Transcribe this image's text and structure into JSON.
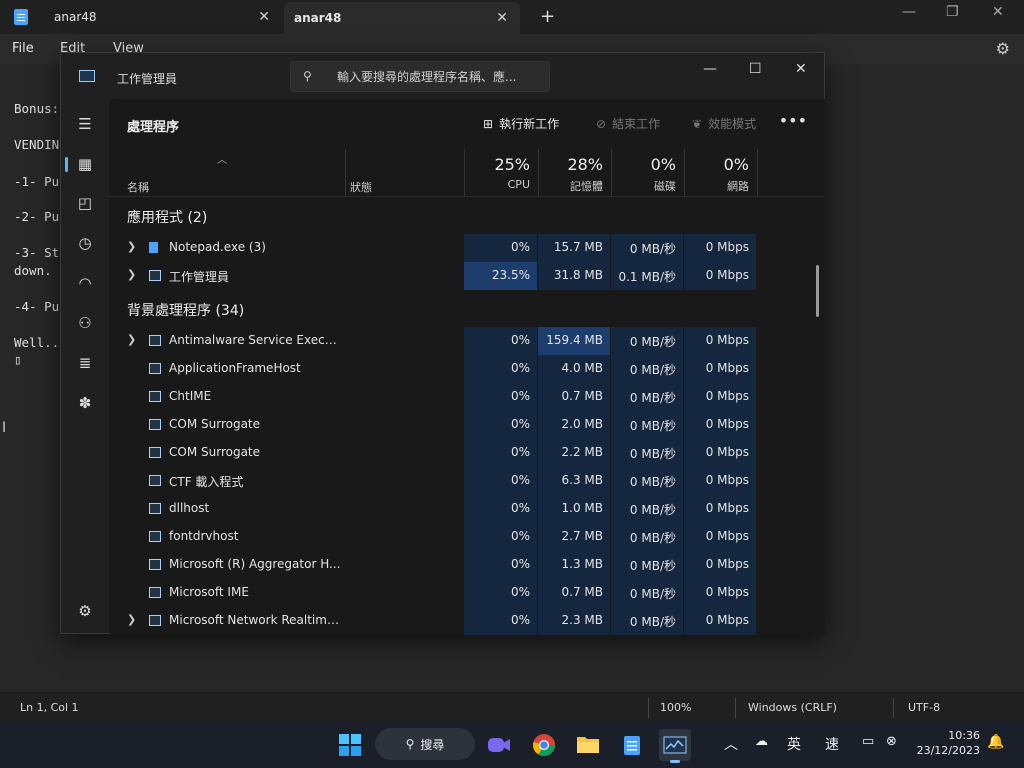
{
  "notepad": {
    "tabs": [
      {
        "label": "anar48"
      },
      {
        "label": "anar48"
      }
    ],
    "new_tab_symbol": "+",
    "menu": [
      "File",
      "Edit",
      "View"
    ],
    "lines": [
      "Bonus:",
      "VENDIN",
      "-1- Pu",
      "-2- Pu",
      "-3- St",
      "down.",
      "-4- Pu",
      "Well..",
      "▯"
    ],
    "status": {
      "position": "Ln 1, Col 1",
      "zoom": "100%",
      "line_ending": "Windows (CRLF)",
      "encoding": "UTF-8"
    }
  },
  "task_manager": {
    "title": "工作管理員",
    "search_placeholder": "輸入要搜尋的處理程序名稱、應...",
    "page_title": "處理程序",
    "commands": {
      "run_new": "執行新工作",
      "end_task": "結束工作",
      "efficiency": "效能模式"
    },
    "columns": {
      "name": "名稱",
      "status": "狀態",
      "cpu": {
        "pct": "25%",
        "label": "CPU"
      },
      "memory": {
        "pct": "28%",
        "label": "記憶體"
      },
      "disk": {
        "pct": "0%",
        "label": "磁碟"
      },
      "network": {
        "pct": "0%",
        "label": "網路"
      }
    },
    "groups": {
      "apps": "應用程式 (2)",
      "background": "背景處理程序 (34)"
    },
    "apps": [
      {
        "name": "Notepad.exe (3)",
        "cpu": "0%",
        "mem": "15.7 MB",
        "disk": "0 MB/秒",
        "net": "0 Mbps"
      },
      {
        "name": "工作管理員",
        "cpu": "23.5%",
        "mem": "31.8 MB",
        "disk": "0.1 MB/秒",
        "net": "0 Mbps"
      }
    ],
    "background": [
      {
        "name": "Antimalware Service Executa...",
        "cpu": "0%",
        "mem": "159.4 MB",
        "disk": "0 MB/秒",
        "net": "0 Mbps"
      },
      {
        "name": "ApplicationFrameHost",
        "cpu": "0%",
        "mem": "4.0 MB",
        "disk": "0 MB/秒",
        "net": "0 Mbps"
      },
      {
        "name": "ChtIME",
        "cpu": "0%",
        "mem": "0.7 MB",
        "disk": "0 MB/秒",
        "net": "0 Mbps"
      },
      {
        "name": "COM Surrogate",
        "cpu": "0%",
        "mem": "2.0 MB",
        "disk": "0 MB/秒",
        "net": "0 Mbps"
      },
      {
        "name": "COM Surrogate",
        "cpu": "0%",
        "mem": "2.2 MB",
        "disk": "0 MB/秒",
        "net": "0 Mbps"
      },
      {
        "name": "CTF 載入程式",
        "cpu": "0%",
        "mem": "6.3 MB",
        "disk": "0 MB/秒",
        "net": "0 Mbps"
      },
      {
        "name": "dllhost",
        "cpu": "0%",
        "mem": "1.0 MB",
        "disk": "0 MB/秒",
        "net": "0 Mbps"
      },
      {
        "name": "fontdrvhost",
        "cpu": "0%",
        "mem": "2.7 MB",
        "disk": "0 MB/秒",
        "net": "0 Mbps"
      },
      {
        "name": "Microsoft (R) Aggregator H...",
        "cpu": "0%",
        "mem": "1.3 MB",
        "disk": "0 MB/秒",
        "net": "0 Mbps"
      },
      {
        "name": "Microsoft IME",
        "cpu": "0%",
        "mem": "0.7 MB",
        "disk": "0 MB/秒",
        "net": "0 Mbps"
      },
      {
        "name": "Microsoft Network Realtime...",
        "cpu": "0%",
        "mem": "2.3 MB",
        "disk": "0 MB/秒",
        "net": "0 Mbps"
      }
    ]
  },
  "taskbar": {
    "search_label": "搜尋",
    "ime_lang": "英",
    "ime_mode": "速",
    "time": "10:36",
    "date": "23/12/2023"
  },
  "colors": {
    "accent": "#5cb4ff",
    "heat_low": "#14273f",
    "heat_mid": "#1a3256",
    "heat_high": "#1d3d6d"
  }
}
